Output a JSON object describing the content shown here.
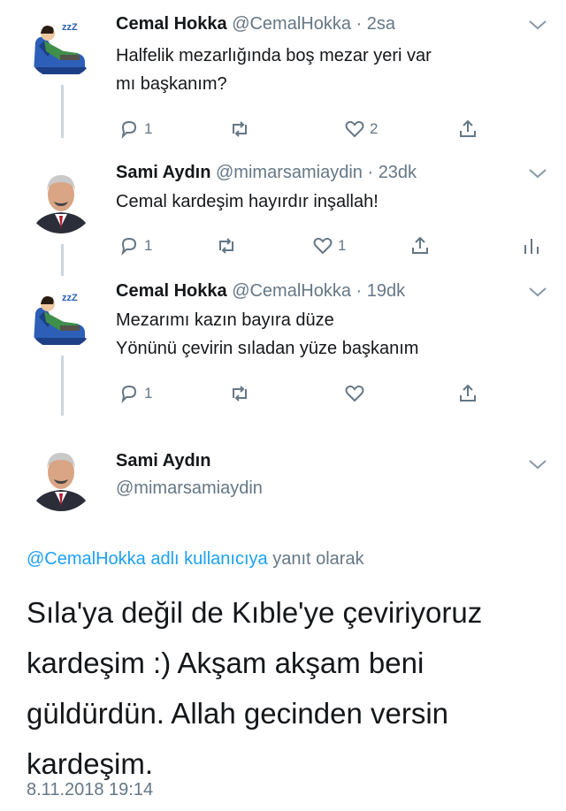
{
  "tweets": [
    {
      "name": "Cemal Hokka",
      "handle": "@CemalHokka",
      "separator": "·",
      "time": "2sa",
      "lines": [
        "Halfelik mezarlığında boş mezar yeri var",
        "mı başkanım?"
      ],
      "replies": "1",
      "retweets": "",
      "likes": "2",
      "avatar_icon": "sleeping-man-armchair-icon"
    },
    {
      "name": "Sami Aydın",
      "handle": "@mimarsamiaydin",
      "separator": "·",
      "time": "23dk",
      "lines": [
        "Cemal kardeşim hayırdır inşallah!"
      ],
      "replies": "1",
      "retweets": "",
      "likes": "1",
      "avatar_icon": "man-portrait-icon"
    },
    {
      "name": "Cemal Hokka",
      "handle": "@CemalHokka",
      "separator": "·",
      "time": "19dk",
      "lines": [
        "Mezarımı kazın bayıra düze",
        "Yönünü çevirin sıladan yüze başkanım"
      ],
      "replies": "1",
      "retweets": "",
      "likes": "",
      "avatar_icon": "sleeping-man-armchair-icon"
    }
  ],
  "main": {
    "name": "Sami Aydın",
    "handle": "@mimarsamiaydin",
    "reply_link": "@CemalHokka adlı kullanıcıya",
    "reply_suffix": " yanıt olarak",
    "text_lines": [
      "Sıla'ya değil de Kıble'ye çeviriyoruz",
      "kardeşim :) Akşam akşam beni",
      "güldürdün. Allah gecinden versin",
      "kardeşim."
    ],
    "timestamp": "8.11.2018 19:14"
  },
  "colors": {
    "text": "#14171a",
    "muted": "#657786",
    "link": "#1da1f2",
    "thread_line": "#ccd6dd"
  }
}
